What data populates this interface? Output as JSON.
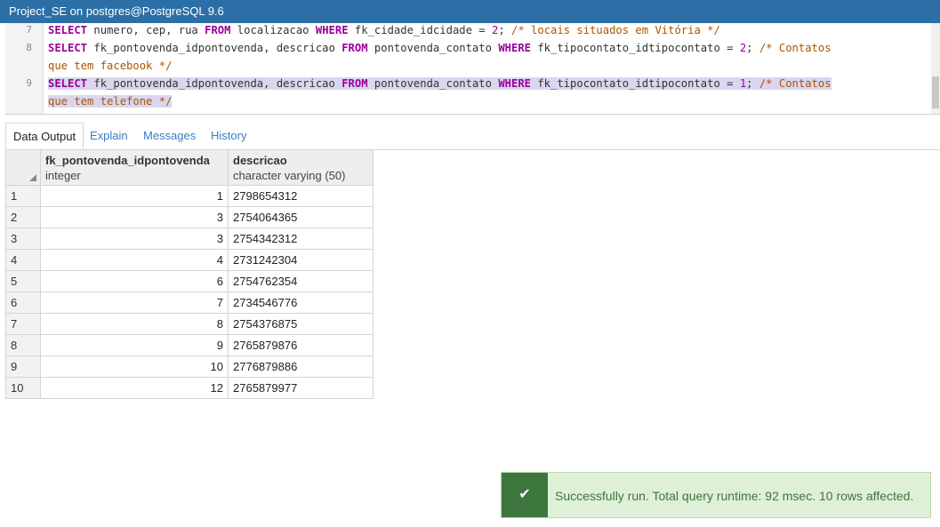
{
  "window": {
    "title": "Project_SE on postgres@PostgreSQL 9.6"
  },
  "editor": {
    "lines": [
      {
        "num": "7"
      },
      {
        "num": "8"
      },
      {
        "num": "9"
      }
    ],
    "code": {
      "l7": {
        "kw1": "SELECT",
        "t1": " numero, cep, rua ",
        "kw2": "FROM",
        "t2": " localizacao ",
        "kw3": "WHERE",
        "t3": " fk_cidade_idcidade = ",
        "n": "2",
        "t4": "; ",
        "c": "/* locais situados em Vitória */"
      },
      "l8": {
        "kw1": "SELECT",
        "t1": " fk_pontovenda_idpontovenda, descricao ",
        "kw2": "FROM",
        "t2": " pontovenda_contato ",
        "kw3": "WHERE",
        "t3": " fk_tipocontato_idtipocontato = ",
        "n": "2",
        "t4": "; ",
        "c": "/* Contatos",
        "c2": "que tem facebook */"
      },
      "l9": {
        "kw1": "SELECT",
        "t1": " fk_pontovenda_idpontovenda, descricao ",
        "kw2": "FROM",
        "t2": " pontovenda_contato ",
        "kw3": "WHERE",
        "t3": " fk_tipocontato_idtipocontato = ",
        "n": "1",
        "t4": "; ",
        "c": "/* Contatos",
        "c2": "que tem telefone */"
      }
    }
  },
  "tabs": [
    {
      "label": "Data Output"
    },
    {
      "label": "Explain"
    },
    {
      "label": "Messages"
    },
    {
      "label": "History"
    }
  ],
  "grid": {
    "columns": [
      {
        "name": "fk_pontovenda_idpontovenda",
        "type": "integer"
      },
      {
        "name": "descricao",
        "type": "character varying (50)"
      }
    ],
    "rows": [
      {
        "n": "1",
        "id": "1",
        "desc": "2798654312"
      },
      {
        "n": "2",
        "id": "3",
        "desc": "2754064365"
      },
      {
        "n": "3",
        "id": "3",
        "desc": "2754342312"
      },
      {
        "n": "4",
        "id": "4",
        "desc": "2731242304"
      },
      {
        "n": "5",
        "id": "6",
        "desc": "2754762354"
      },
      {
        "n": "6",
        "id": "7",
        "desc": "2734546776"
      },
      {
        "n": "7",
        "id": "8",
        "desc": "2754376875"
      },
      {
        "n": "8",
        "id": "9",
        "desc": "2765879876"
      },
      {
        "n": "9",
        "id": "10",
        "desc": "2776879886"
      },
      {
        "n": "10",
        "id": "12",
        "desc": "2765879977"
      }
    ]
  },
  "toast": {
    "icon": "check-icon",
    "message": "Successfully run. Total query runtime: 92 msec. 10 rows affected."
  },
  "colors": {
    "titlebar": "#2c6fa6",
    "keyword": "#990099",
    "comment": "#aa5500",
    "tab_link": "#3b7cc4",
    "toast_bg": "#dff0d8",
    "toast_icon_bg": "#3c763d"
  }
}
